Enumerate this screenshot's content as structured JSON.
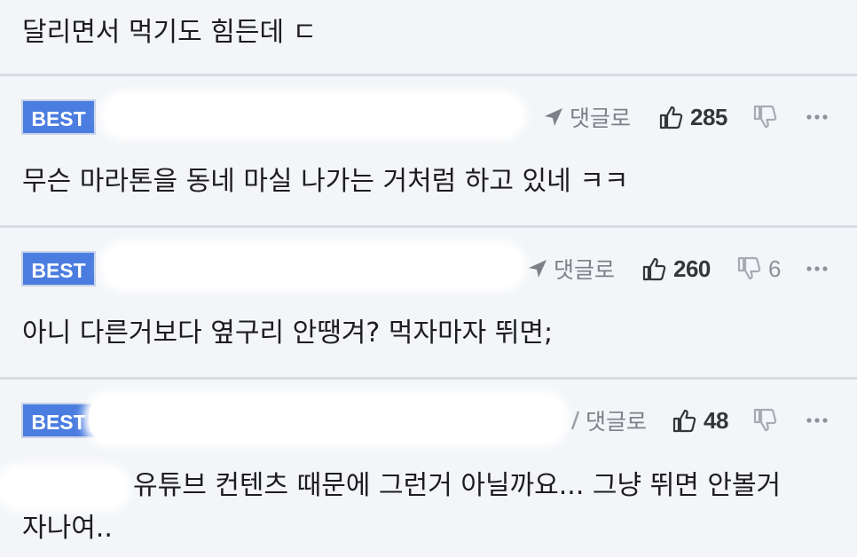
{
  "comments": [
    {
      "text": "달리면서 먹기도 힘든데 ㄷ"
    },
    {
      "badge": "BEST",
      "reply_label": "댓글로",
      "likes": "285",
      "dislikes": "",
      "text": "무슨 마라톤을 동네 마실 나가는 거처럼 하고 있네 ㅋㅋ"
    },
    {
      "badge": "BEST",
      "reply_label": "댓글로",
      "likes": "260",
      "dislikes": "6",
      "text": "아니 다른거보다 옆구리 안땡겨? 먹자마자 뛰면;"
    },
    {
      "badge": "BEST",
      "reply_label": "댓글로",
      "likes": "48",
      "dislikes": "",
      "text_line1": "유튜브 컨텐츠 때문에 그런거 아닐까요... 그냥 뛰면 안볼거",
      "text_line2": "자나여.."
    }
  ],
  "icons": {
    "reply": "reply-arrow-icon",
    "like": "thumbs-up-icon",
    "dislike": "thumbs-down-icon",
    "more": "more-dots-icon"
  },
  "colors": {
    "best_badge": "#4b7de0",
    "background": "#f3f5f8",
    "divider": "#d9dce2"
  }
}
